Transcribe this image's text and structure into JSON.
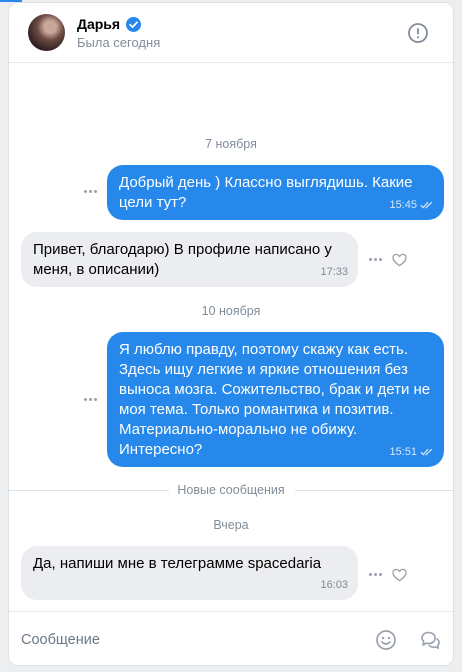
{
  "header": {
    "name": "Дарья",
    "status": "Была сегодня"
  },
  "messages": [
    {
      "date": "7 ноября"
    },
    {
      "direction": "out",
      "text": "Добрый день ) Классно выглядишь. Какие цели тут?",
      "time": "15:45"
    },
    {
      "direction": "in",
      "text": "Привет, благодарю) В профиле написано у меня, в описании)",
      "time": "17:33"
    },
    {
      "date": "10 ноября"
    },
    {
      "direction": "out",
      "text": "Я люблю правду, поэтому скажу как есть. Здесь ищу легкие и яркие отношения без выноса мозга. Сожительство, брак и дети не моя тема. Только романтика и позитив. Материально-морально не обижу. Интересно?",
      "time": "15:51"
    },
    {
      "separator": "Новые сообщения"
    },
    {
      "date": "Вчера"
    },
    {
      "direction": "in",
      "text": "Да, напиши мне в телеграмме spacedaria",
      "time": "16:03"
    }
  ],
  "composer": {
    "placeholder": "Сообщение"
  },
  "colors": {
    "accent": "#2688eb",
    "incoming_bubble": "#ebedf0",
    "secondary_text": "#818c99"
  }
}
